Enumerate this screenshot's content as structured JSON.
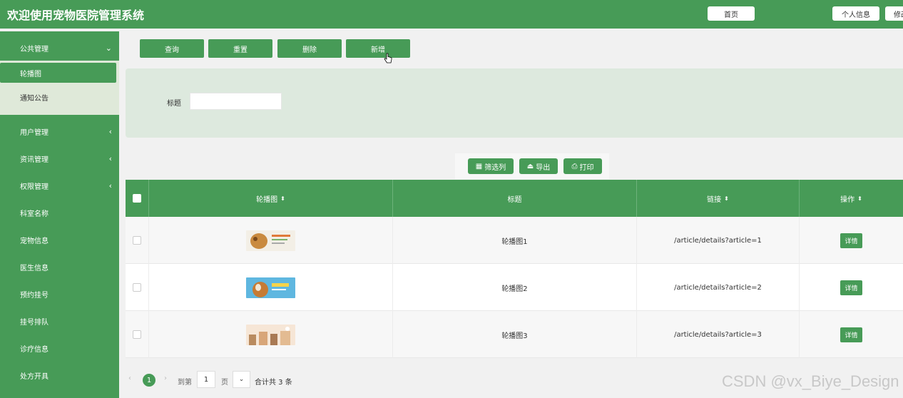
{
  "header": {
    "title": "欢迎使用宠物医院管理系统",
    "home_btn": "首页",
    "profile_btn": "个人信息",
    "extra_btn": "修改"
  },
  "sidebar": {
    "public_menu": "公共管理",
    "sub_items": [
      "轮播图",
      "通知公告"
    ],
    "items": [
      "用户管理",
      "资讯管理",
      "权限管理",
      "科室名称",
      "宠物信息",
      "医生信息",
      "预约挂号",
      "挂号排队",
      "诊疗信息",
      "处方开具"
    ]
  },
  "toolbar": {
    "query": "查询",
    "reset": "重置",
    "delete": "删除",
    "add": "新增"
  },
  "search": {
    "label": "标题",
    "value": ""
  },
  "utility": {
    "filter": "筛选列",
    "export": "导出",
    "print": "打印"
  },
  "table": {
    "headers": [
      "轮播图",
      "标题",
      "链接",
      "操作"
    ],
    "rows": [
      {
        "title": "轮播图1",
        "link": "/article/details?article=1",
        "action": "详情"
      },
      {
        "title": "轮播图2",
        "link": "/article/details?article=2",
        "action": "详情"
      },
      {
        "title": "轮播图3",
        "link": "/article/details?article=3",
        "action": "详情"
      }
    ]
  },
  "pagination": {
    "prev": "‹",
    "current": "1",
    "next": "›",
    "goto": "到第",
    "page_value": "1",
    "page_unit": "页",
    "total": "合计共 3 条"
  },
  "watermark": "CSDN @vx_Biye_Design",
  "colors": {
    "primary": "#479b57",
    "panel": "#dde9de",
    "submenu": "#dfe9d9"
  }
}
